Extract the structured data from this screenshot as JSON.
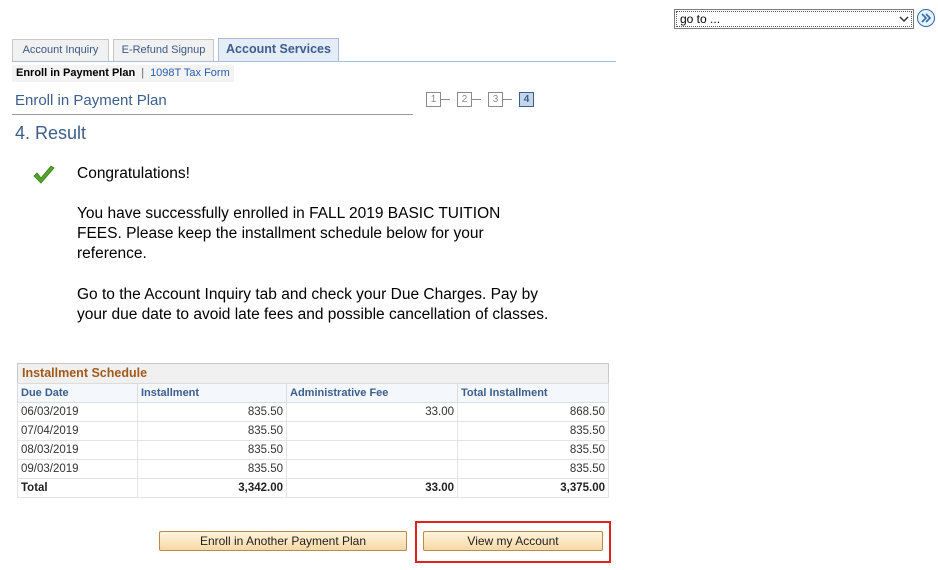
{
  "goto": {
    "label": "go to ..."
  },
  "tabs": [
    {
      "label": "Account Inquiry",
      "active": false
    },
    {
      "label": "E-Refund Signup",
      "active": false
    },
    {
      "label": "Account Services",
      "active": true
    }
  ],
  "subnav": {
    "current": "Enroll in Payment Plan",
    "separator": "|",
    "link": "1098T Tax Form"
  },
  "page": {
    "title": "Enroll in Payment Plan",
    "steps": [
      "1",
      "2",
      "3",
      "4"
    ],
    "current_step": "4",
    "result_heading": "4. Result"
  },
  "message": {
    "congrats": "Congratulations!",
    "para1": "You have successfully enrolled in FALL 2019 BASIC TUITION FEES.  Please keep the installment schedule below for your reference.",
    "para2": "Go to the Account Inquiry tab and check your Due Charges. Pay by your due date to avoid late fees and possible cancellation of classes."
  },
  "schedule": {
    "title": "Installment Schedule",
    "headers": [
      "Due Date",
      "Installment",
      "Administrative Fee",
      "Total Installment"
    ],
    "rows": [
      [
        "06/03/2019",
        "835.50",
        "33.00",
        "868.50"
      ],
      [
        "07/04/2019",
        "835.50",
        "",
        "835.50"
      ],
      [
        "08/03/2019",
        "835.50",
        "",
        "835.50"
      ],
      [
        "09/03/2019",
        "835.50",
        "",
        "835.50"
      ]
    ],
    "total": [
      "Total",
      "3,342.00",
      "33.00",
      "3,375.00"
    ]
  },
  "buttons": {
    "another": "Enroll in Another Payment Plan",
    "view": "View my Account"
  },
  "colors": {
    "highlight": "#e0231d",
    "heading": "#3d5e8c",
    "schedule_title": "#a25a1a"
  }
}
